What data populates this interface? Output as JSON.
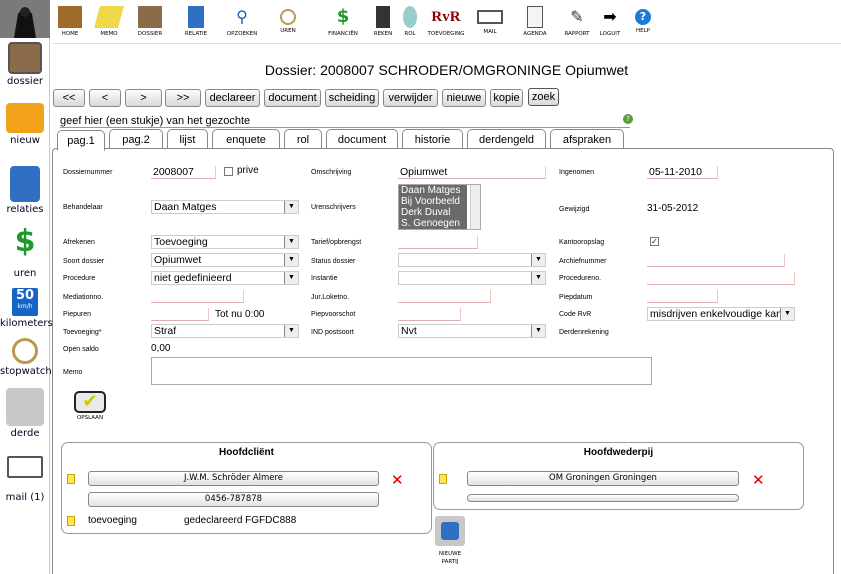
{
  "sidebar": {
    "items": [
      {
        "label": ""
      },
      {
        "label": "dossier"
      },
      {
        "label": "nieuw"
      },
      {
        "label": "relaties"
      },
      {
        "label": "uren"
      },
      {
        "label": "kilometers",
        "icon_text": "50",
        "icon_sub": "km/h"
      },
      {
        "label": "stopwatch"
      },
      {
        "label": "derde"
      },
      {
        "label": "mail (1)"
      }
    ]
  },
  "toolbar": {
    "items": [
      "HOME",
      "MEMO",
      "DOSSIER",
      "RELATIE",
      "OPZOEKEN",
      "UREN",
      "FINANCIËN",
      "REKEN",
      "ROL",
      "TOEVOEGING",
      "MAIL",
      "AGENDA",
      "RAPPORT",
      "LOGUIT",
      "HELP"
    ],
    "rvr_logo": "RvR"
  },
  "page": {
    "title": "Dossier: 2008007 SCHRODER/OMGRONINGE Opiumwet"
  },
  "nav_buttons": [
    "<<",
    "<",
    ">",
    ">>",
    "declareer",
    "document",
    "scheiding",
    "verwijder",
    "nieuwe",
    "kopie",
    "zoek"
  ],
  "search": {
    "value": "geef hier (een stukje) van het gezochte"
  },
  "tabs": [
    "pag.1",
    "pag.2",
    "lijst",
    "enquete",
    "rol",
    "document",
    "historie",
    "derdengeld",
    "afspraken"
  ],
  "form": {
    "dossiernummer_label": "Dossiernummer",
    "dossiernummer": "2008007",
    "prive_label": "prive",
    "omschrijving_label": "Omschrijving",
    "omschrijving": "Opiumwet",
    "ingenomen_label": "Ingenomen",
    "ingenomen": "05-11-2010",
    "behandelaar_label": "Behandelaar",
    "behandelaar": "Daan Matges",
    "urenschrijvers_label": "Urenschrijvers",
    "urenschrijvers": [
      "Daan Matges",
      "Bij Voorbeeld",
      "Derk Duval",
      "S. Genoegen"
    ],
    "gewijzigd_label": "Gewijzigd",
    "gewijzigd": "31-05-2012",
    "afrekenen_label": "Afrekenen",
    "afrekenen": "Toevoeging",
    "tarief_label": "Tarief/opbrengst",
    "kantoor_label": "Kantooropslag",
    "kantoor_checked": true,
    "soort_label": "Soort dossier",
    "soort": "Opiumwet",
    "status_label": "Status dossier",
    "archief_label": "Archiefnummer",
    "procedure_label": "Procedure",
    "procedure": "niet gedefinieerd",
    "instantie_label": "Instantie",
    "procedureno_label": "Procedureno.",
    "mediation_label": "Mediationno.",
    "jurloket_label": "Jur.Loketno.",
    "piepdatum_label": "Piepdatum",
    "piepuren_label": "Piepuren",
    "tot_nu": "Tot nu 0:00",
    "piepvoorschot_label": "Piepvoorschot",
    "coderv_label": "Code RvR",
    "coderv": "misdrijven enkelvoudige kamer",
    "toevoeging_label": "Toevoeging*",
    "toevoeging": "Straf",
    "indpost_label": "IND postsoort",
    "indpost": "Nvt",
    "derdenrek_label": "Derdenrekening",
    "opensaldo_label": "Open saldo",
    "opensaldo": "0,00",
    "memo_label": "Memo",
    "opslaan": "OPSLAAN"
  },
  "client_box": {
    "title": "Hoofdcliënt",
    "name": "J.W.M. Schröder Almere",
    "phone": "0456-787878",
    "toevoeging_label": "toevoeging",
    "toevoeging_value": "gedeclareerd FGFDC888"
  },
  "party_box": {
    "title": "Hoofdwederpij",
    "name": "OM Groningen Groningen",
    "second": ""
  },
  "new_party": {
    "line1": "NIEUWE",
    "line2": "PARTIJ"
  }
}
